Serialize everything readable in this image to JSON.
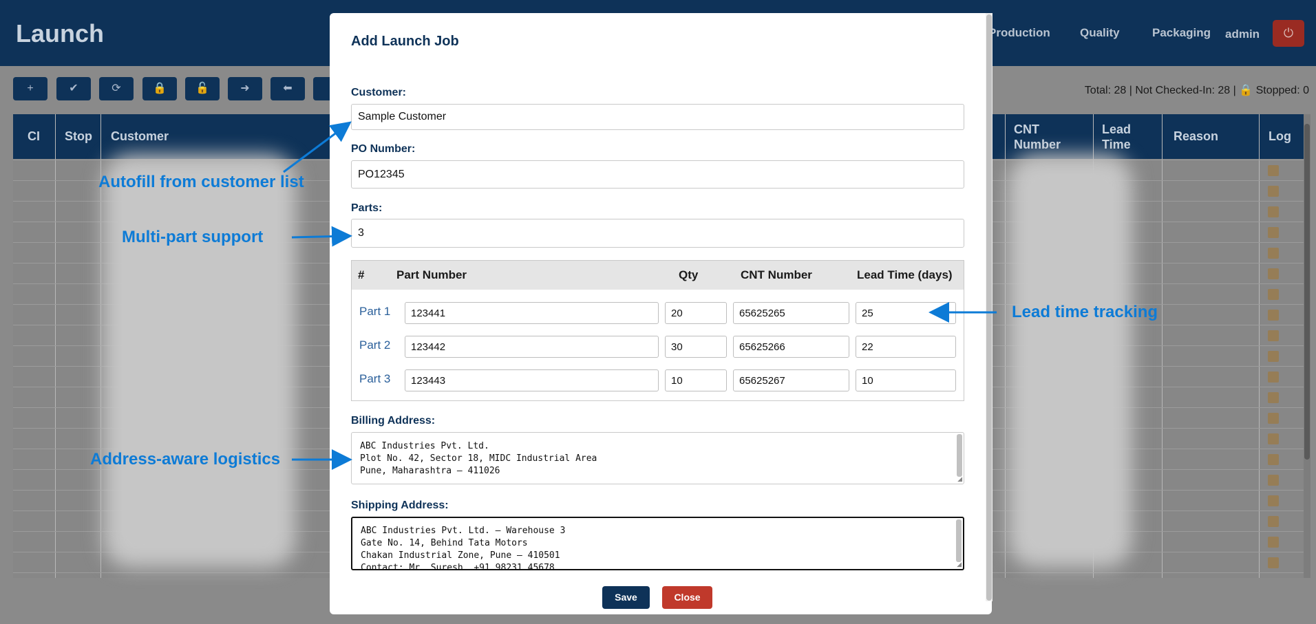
{
  "app": {
    "title": "Launch",
    "user": "admin"
  },
  "nav": {
    "production": "Production",
    "quality": "Quality",
    "packaging": "Packaging"
  },
  "toolbar": {
    "icons": [
      "plus-icon",
      "check-icon",
      "refresh-icon",
      "lock-icon",
      "unlock-icon",
      "arrow-right-icon",
      "arrow-left-icon"
    ],
    "summary": "Total: 28 | Not Checked-In: 28 | 🔒 Stopped: 0"
  },
  "table": {
    "headers": {
      "ci": "CI",
      "stop": "Stop",
      "customer": "Customer",
      "cnt_number": "CNT Number",
      "lead_time": "Lead Time",
      "reason": "Reason",
      "log": "Log"
    }
  },
  "annotations": {
    "autofill": "Autofill from customer list",
    "multipart": "Multi-part support",
    "leadtime": "Lead time tracking",
    "address": "Address-aware logistics"
  },
  "modal": {
    "title": "Add Launch Job",
    "customer_label": "Customer:",
    "customer_value": "Sample Customer",
    "po_label": "PO Number:",
    "po_value": "PO12345",
    "parts_label": "Parts:",
    "parts_value": "3",
    "parts_table": {
      "headers": {
        "num": "#",
        "part_number": "Part Number",
        "qty": "Qty",
        "cnt": "CNT Number",
        "lead": "Lead Time (days)"
      },
      "rows": [
        {
          "label": "Part 1",
          "part_number": "123441",
          "qty": "20",
          "cnt": "65625265",
          "lead": "25"
        },
        {
          "label": "Part 2",
          "part_number": "123442",
          "qty": "30",
          "cnt": "65625266",
          "lead": "22"
        },
        {
          "label": "Part 3",
          "part_number": "123443",
          "qty": "10",
          "cnt": "65625267",
          "lead": "10"
        }
      ]
    },
    "billing_label": "Billing Address:",
    "billing_lines": [
      "ABC Industries Pvt. Ltd.",
      "Plot No. 42, Sector 18, MIDC Industrial Area",
      "Pune, Maharashtra – 411026"
    ],
    "shipping_label": "Shipping Address:",
    "shipping_lines": [
      "ABC Industries Pvt. Ltd. – Warehouse 3",
      "Gate No. 14, Behind Tata Motors",
      "Chakan Industrial Zone, Pune – 410501",
      "Contact: Mr. Suresh, +91 98231 45678"
    ],
    "save_label": "Save",
    "close_label": "Close"
  },
  "colors": {
    "header_bg": "#0e3258",
    "annotation": "#0d7bd6",
    "close_btn": "#c0392b",
    "save_btn": "#0e3258"
  }
}
